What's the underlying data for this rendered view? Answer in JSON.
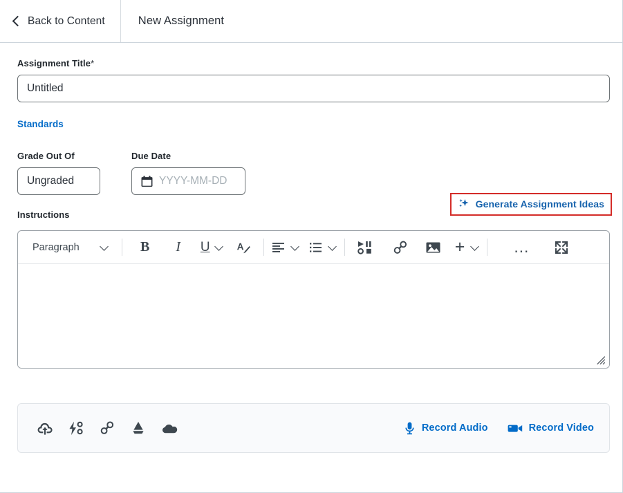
{
  "header": {
    "back_label": "Back to Content",
    "back_icon": "chevron-left-icon",
    "title": "New Assignment"
  },
  "form": {
    "title_label": "Assignment Title",
    "title_required_marker": "*",
    "title_value": "Untitled",
    "title_placeholder": "Untitled",
    "standards_link": "Standards",
    "grade_label": "Grade Out Of",
    "grade_value": "Ungraded",
    "grade_placeholder": "Ungraded",
    "due_label": "Due Date",
    "due_value": "",
    "due_placeholder": "YYYY-MM-DD",
    "due_icon": "calendar-icon",
    "instructions_label": "Instructions"
  },
  "generate": {
    "label": "Generate Assignment Ideas",
    "icon": "sparkle-icon",
    "text_color": "#1763ad",
    "highlight_color": "#d42c28"
  },
  "editor": {
    "toolbar": [
      {
        "name": "paragraph-style-select",
        "label": "Paragraph",
        "icon": "chevron-down-icon"
      },
      {
        "name": "bold-button",
        "label": "B",
        "icon": "bold-icon"
      },
      {
        "name": "italic-button",
        "label": "I",
        "icon": "italic-icon"
      },
      {
        "name": "underline-button",
        "label": "U",
        "icon": "underline-icon"
      },
      {
        "name": "text-format-button",
        "label": "",
        "icon": "format-text-icon"
      },
      {
        "name": "align-button",
        "label": "",
        "icon": "align-left-icon"
      },
      {
        "name": "list-button",
        "label": "",
        "icon": "bulleted-list-icon"
      },
      {
        "name": "insert-stuff-button",
        "label": "",
        "icon": "media-controls-icon"
      },
      {
        "name": "insert-link-button",
        "label": "",
        "icon": "link-icon"
      },
      {
        "name": "insert-image-button",
        "label": "",
        "icon": "image-icon"
      },
      {
        "name": "insert-more-button",
        "label": "+",
        "icon": "plus-icon"
      },
      {
        "name": "overflow-button",
        "label": "…",
        "icon": "ellipsis-icon"
      },
      {
        "name": "fullscreen-button",
        "label": "",
        "icon": "expand-icon"
      }
    ],
    "content": "",
    "resize_handle": "resize-grip-icon"
  },
  "attachments": {
    "items": [
      {
        "name": "upload-file-button",
        "icon": "upload-cloud-icon"
      },
      {
        "name": "quicklink-button",
        "icon": "lightning-quicklink-icon"
      },
      {
        "name": "insert-link-button",
        "icon": "link-icon"
      },
      {
        "name": "google-drive-button",
        "icon": "google-drive-icon"
      },
      {
        "name": "onedrive-button",
        "icon": "onedrive-cloud-icon"
      }
    ],
    "record_audio_label": "Record Audio",
    "record_audio_icon": "microphone-icon",
    "record_video_label": "Record Video",
    "record_video_icon": "video-camera-icon",
    "accent_color": "#026bc8"
  }
}
